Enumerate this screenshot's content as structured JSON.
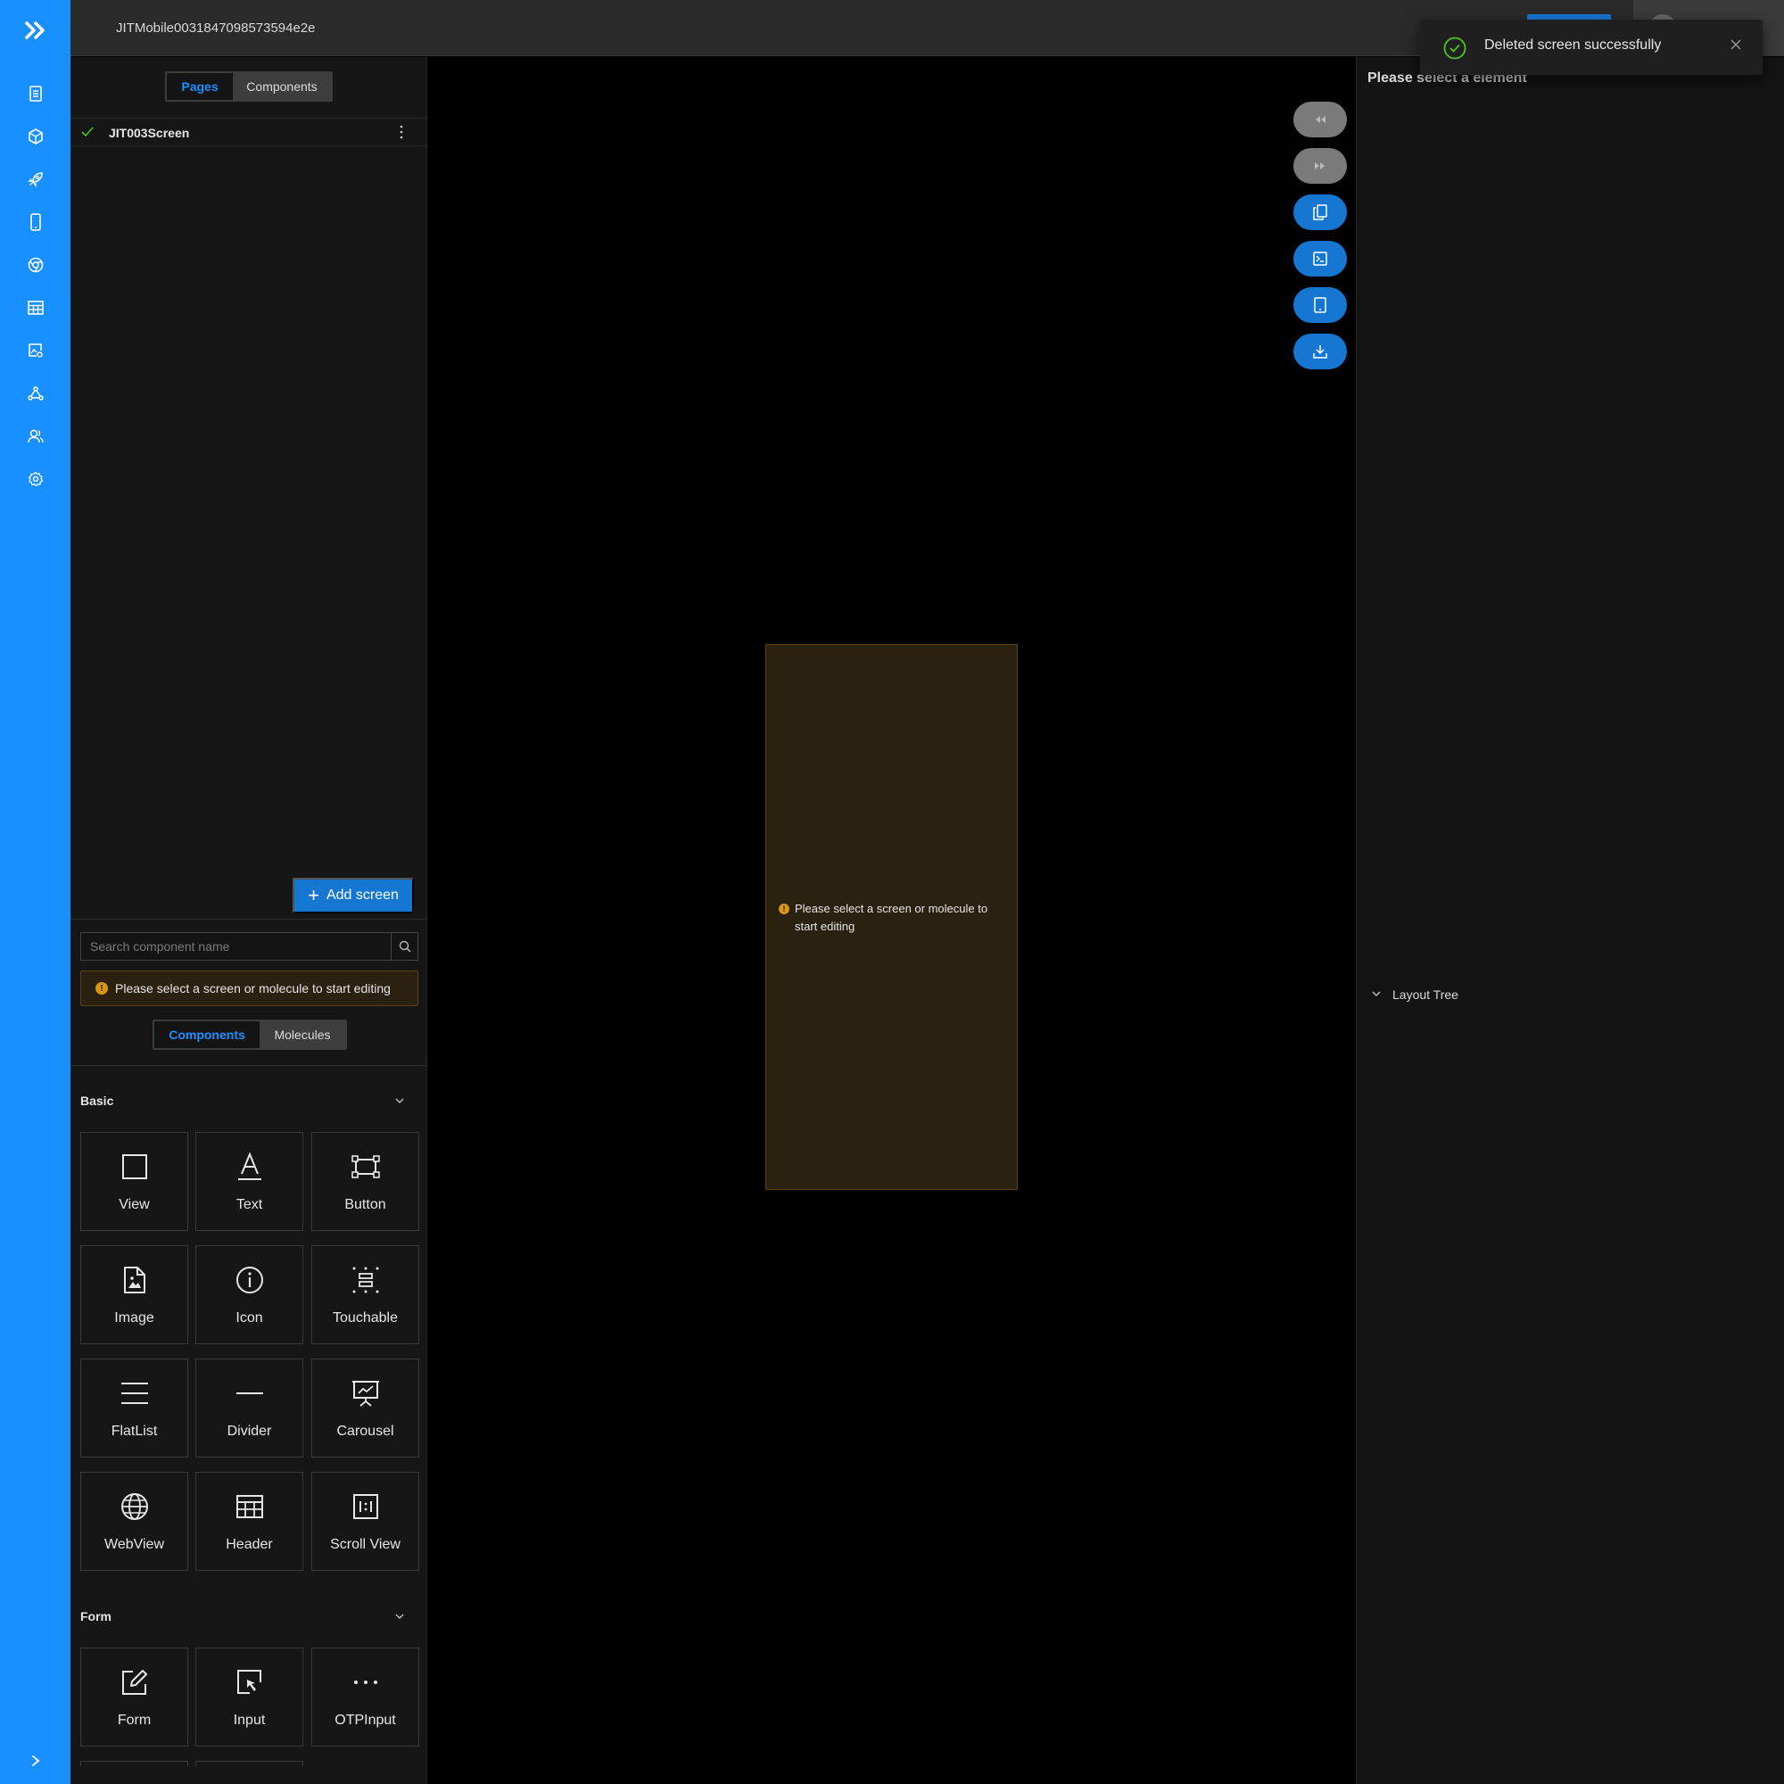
{
  "app": {
    "title": "JITMobile0031847098573594e2e"
  },
  "rail": {
    "icons": [
      "logo-double-chevron-icon",
      "document-icon",
      "cube-icon",
      "rocket-icon",
      "mobile-icon",
      "chrome-icon",
      "table-icon",
      "image-settings-icon",
      "network-icon",
      "users-icon",
      "gear-icon",
      "expand-chevron-icon"
    ]
  },
  "pages_panel": {
    "tabs": [
      {
        "label": "Pages",
        "active": true
      },
      {
        "label": "Components",
        "active": false
      }
    ],
    "screens": [
      {
        "name": "JIT003Screen",
        "status": "selected"
      }
    ],
    "add_screen_label": "Add screen"
  },
  "components_panel": {
    "search": {
      "placeholder": "Search component name",
      "value": ""
    },
    "notice": "Please select a screen or molecule to start editing",
    "tabs": [
      {
        "label": "Components",
        "active": true
      },
      {
        "label": "Molecules",
        "active": false
      }
    ],
    "sections": [
      {
        "title": "Basic",
        "items": [
          {
            "label": "View",
            "icon": "square-icon"
          },
          {
            "label": "Text",
            "icon": "text-icon"
          },
          {
            "label": "Button",
            "icon": "button-frame-icon"
          },
          {
            "label": "Image",
            "icon": "image-file-icon"
          },
          {
            "label": "Icon",
            "icon": "info-circle-icon"
          },
          {
            "label": "Touchable",
            "icon": "touchable-icon"
          },
          {
            "label": "FlatList",
            "icon": "list-lines-icon"
          },
          {
            "label": "Divider",
            "icon": "minus-line-icon"
          },
          {
            "label": "Carousel",
            "icon": "presentation-icon"
          },
          {
            "label": "WebView",
            "icon": "globe-icon"
          },
          {
            "label": "Header",
            "icon": "table-grid-icon"
          },
          {
            "label": "Scroll View",
            "icon": "scroll-view-icon"
          }
        ]
      },
      {
        "title": "Form",
        "items": [
          {
            "label": "Form",
            "icon": "edit-form-icon"
          },
          {
            "label": "Input",
            "icon": "input-cursor-icon"
          },
          {
            "label": "OTPInput",
            "icon": "dots-icon"
          }
        ]
      }
    ]
  },
  "canvas": {
    "empty_message": "Please select a screen or molecule to start editing",
    "toolbar": [
      "undo-icon",
      "redo-icon",
      "copy-icon",
      "terminal-icon",
      "device-icon",
      "download-icon"
    ]
  },
  "properties_panel": {
    "title": "Please select a element",
    "layout_tree_label": "Layout Tree"
  },
  "toast": {
    "message": "Deleted screen successfully"
  },
  "colors": {
    "accent": "#1890ff",
    "primary_button": "#1677d2",
    "warning": "#d89614",
    "success": "#52c41a"
  }
}
